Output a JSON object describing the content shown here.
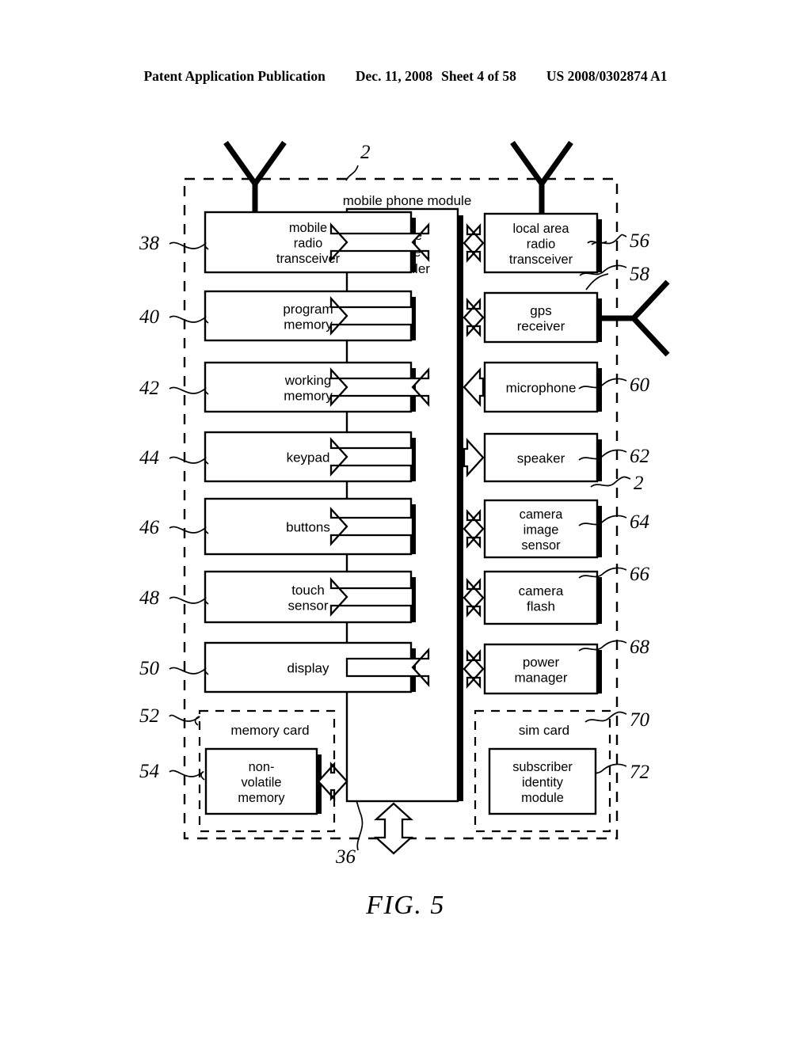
{
  "header": {
    "publication": "Patent Application Publication",
    "date": "Dec. 11, 2008",
    "sheet": "Sheet 4 of 58",
    "number": "US 2008/0302874 A1"
  },
  "figure": {
    "caption": "FIG. 5",
    "module_label": "mobile phone module",
    "module_ref": "2",
    "bus_ref": "36"
  },
  "controller": {
    "label": "mobile phone controller",
    "lines": [
      "mobile",
      "phone",
      "controller"
    ]
  },
  "left_blocks": [
    {
      "ref": "38",
      "lines": [
        "mobile",
        "radio",
        "transceiver"
      ],
      "arrow": "bidirectional"
    },
    {
      "ref": "40",
      "lines": [
        "program",
        "memory"
      ],
      "arrow": "right"
    },
    {
      "ref": "42",
      "lines": [
        "working",
        "memory"
      ],
      "arrow": "bidirectional"
    },
    {
      "ref": "44",
      "lines": [
        "keypad"
      ],
      "arrow": "right"
    },
    {
      "ref": "46",
      "lines": [
        "buttons"
      ],
      "arrow": "right"
    },
    {
      "ref": "48",
      "lines": [
        "touch",
        "sensor"
      ],
      "arrow": "right"
    },
    {
      "ref": "50",
      "lines": [
        "display"
      ],
      "arrow": "left"
    }
  ],
  "right_blocks": [
    {
      "ref": "56",
      "lines": [
        "local area",
        "radio",
        "transceiver"
      ],
      "arrow": "bidirectional"
    },
    {
      "ref": "58",
      "lines": [
        "gps",
        "receiver"
      ],
      "arrow": "bidirectional"
    },
    {
      "ref": "60",
      "lines": [
        "microphone"
      ],
      "arrow": "left"
    },
    {
      "ref": "62",
      "lines": [
        "speaker"
      ],
      "arrow": "right"
    },
    {
      "ref": "64",
      "lines": [
        "camera",
        "image",
        "sensor"
      ],
      "arrow": "bidirectional"
    },
    {
      "ref": "66",
      "lines": [
        "camera",
        "flash"
      ],
      "arrow": "bidirectional"
    },
    {
      "ref": "68",
      "lines": [
        "power",
        "manager"
      ],
      "arrow": "bidirectional"
    }
  ],
  "memory_card": {
    "ref": "52",
    "label": "memory card",
    "inner": {
      "ref": "54",
      "lines": [
        "non-",
        "volatile",
        "memory"
      ],
      "arrow": "bidirectional"
    }
  },
  "sim_card": {
    "ref": "70",
    "label": "sim card",
    "inner": {
      "ref": "72",
      "lines": [
        "subscriber",
        "identity",
        "module"
      ],
      "arrow": "none"
    }
  },
  "boundary_ref_mid": "2",
  "antennas": {
    "mobile_radio": "antenna-icon",
    "local_area": "antenna-icon",
    "gps": "antenna-icon"
  }
}
